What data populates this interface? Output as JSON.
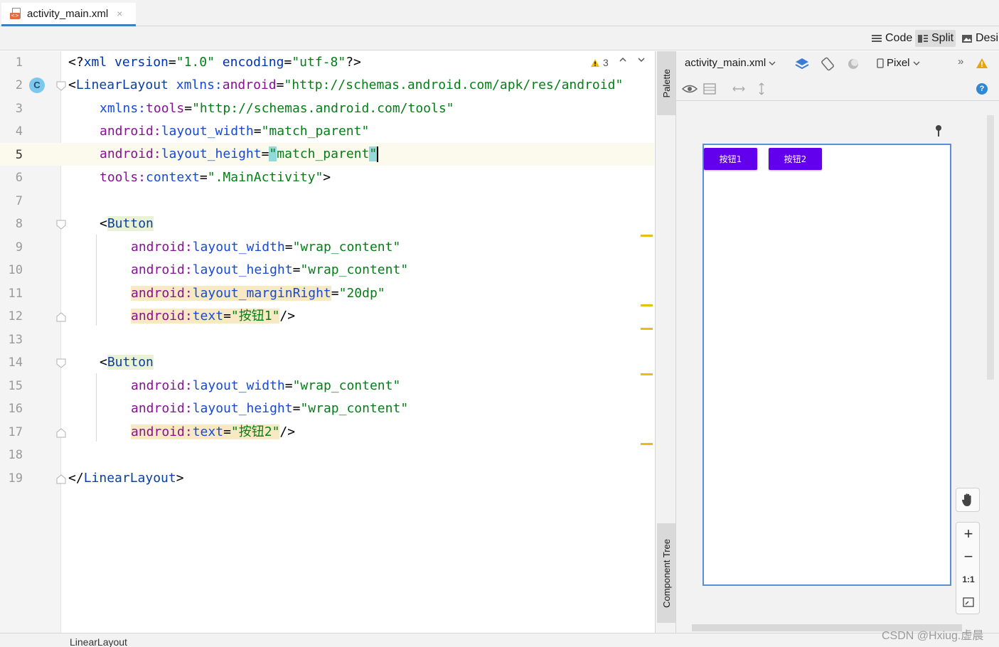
{
  "tab": {
    "file_name": "activity_main.xml",
    "close_glyph": "×",
    "file_icon": "xml-file-icon"
  },
  "view_modes": {
    "code": "Code",
    "split": "Split",
    "design": "Desi",
    "active": "Split"
  },
  "editor": {
    "warning_count": "3",
    "lines": [
      {
        "n": "1"
      },
      {
        "n": "2"
      },
      {
        "n": "3"
      },
      {
        "n": "4"
      },
      {
        "n": "5"
      },
      {
        "n": "6"
      },
      {
        "n": "7"
      },
      {
        "n": "8"
      },
      {
        "n": "9"
      },
      {
        "n": "10"
      },
      {
        "n": "11"
      },
      {
        "n": "12"
      },
      {
        "n": "13"
      },
      {
        "n": "14"
      },
      {
        "n": "15"
      },
      {
        "n": "16"
      },
      {
        "n": "17"
      },
      {
        "n": "18"
      },
      {
        "n": "19"
      }
    ],
    "current_line": "5",
    "gutter_badge": "C",
    "code": {
      "l1": {
        "a": "<?",
        "b": "xml version",
        "c": "=",
        "d": "\"1.0\"",
        "e": " encoding",
        "f": "=",
        "g": "\"utf-8\"",
        "h": "?>"
      },
      "l2": {
        "a": "<",
        "b": "LinearLayout",
        "c": " xmlns:",
        "d": "android",
        "e": "=",
        "f": "\"http://schemas.android.com/apk/res/android\""
      },
      "l3": {
        "a": "xmlns:",
        "b": "tools",
        "c": "=",
        "d": "\"http://schemas.android.com/tools\""
      },
      "l4": {
        "a": "android:",
        "b": "layout_width",
        "c": "=",
        "d": "\"match_parent\""
      },
      "l5": {
        "a": "android:",
        "b": "layout_height",
        "c": "=",
        "q1": "\"",
        "d": "match_parent",
        "q2": "\""
      },
      "l6": {
        "a": "tools:",
        "b": "context",
        "c": "=",
        "d": "\".MainActivity\"",
        "e": ">"
      },
      "l8": {
        "a": "<",
        "b": "Button"
      },
      "l9": {
        "a": "android:",
        "b": "layout_width",
        "c": "=",
        "d": "\"wrap_content\""
      },
      "l10": {
        "a": "android:",
        "b": "layout_height",
        "c": "=",
        "d": "\"wrap_content\""
      },
      "l11": {
        "a": "android:",
        "b": "layout_marginRight",
        "c": "=",
        "d": "\"20dp\""
      },
      "l12": {
        "a": "android:",
        "b": "text",
        "c": "=",
        "d": "\"按钮1\"",
        "e": "/>"
      },
      "l14": {
        "a": "<",
        "b": "Button"
      },
      "l15": {
        "a": "android:",
        "b": "layout_width",
        "c": "=",
        "d": "\"wrap_content\""
      },
      "l16": {
        "a": "android:",
        "b": "layout_height",
        "c": "=",
        "d": "\"wrap_content\""
      },
      "l17": {
        "a": "android:",
        "b": "text",
        "c": "=",
        "d": "\"按钮2\"",
        "e": "/>"
      },
      "l19": {
        "a": "</",
        "b": "LinearLayout",
        "c": ">"
      }
    }
  },
  "side_panel": {
    "palette": "Palette",
    "component_tree": "Component Tree"
  },
  "design": {
    "file_dropdown": "activity_main.xml",
    "device": "Pixel",
    "more": "»",
    "preview_buttons": [
      {
        "label": "按钮1"
      },
      {
        "label": "按钮2"
      }
    ],
    "zoom": {
      "fit_label": "1:1",
      "plus": "+",
      "minus": "−"
    },
    "help": "?"
  },
  "status": {
    "breadcrumb": "LinearLayout"
  },
  "watermark": "CSDN @Hxiug.虚晨",
  "colors": {
    "accent": "#3c7fc9",
    "button": "#6200ee",
    "warning": "#e7bf0d"
  }
}
